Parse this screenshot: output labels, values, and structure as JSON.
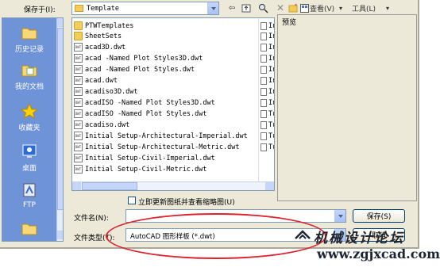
{
  "save_in": {
    "label": "保存于(I):",
    "value": "Template"
  },
  "toolbar": {
    "views_label": "查看(V)",
    "tools_label": "工具(L)"
  },
  "places": [
    {
      "label": "历史记录",
      "icon": "history-folder-icon"
    },
    {
      "label": "我的文档",
      "icon": "my-documents-icon"
    },
    {
      "label": "收藏夹",
      "icon": "favorites-star-icon"
    },
    {
      "label": "桌面",
      "icon": "desktop-icon"
    },
    {
      "label": "FTP",
      "icon": "ftp-icon"
    }
  ],
  "files": [
    {
      "name": "PTWTemplates",
      "type": "folder",
      "col2": ""
    },
    {
      "name": "SheetSets",
      "type": "folder",
      "col2": ""
    },
    {
      "name": "acad3D.dwt",
      "type": "dwt",
      "col2": "In"
    },
    {
      "name": "acad -Named Plot Styles3D.dwt",
      "type": "dwt",
      "col2": "In"
    },
    {
      "name": "acad -Named Plot Styles.dwt",
      "type": "dwt",
      "col2": "In"
    },
    {
      "name": "acad.dwt",
      "type": "dwt",
      "col2": "In"
    },
    {
      "name": "acadiso3D.dwt",
      "type": "dwt",
      "col2": "In"
    },
    {
      "name": "acadISO -Named Plot Styles3D.dwt",
      "type": "dwt",
      "col2": "In"
    },
    {
      "name": "acadISO -Named Plot Styles.dwt",
      "type": "dwt",
      "col2": "Tu"
    },
    {
      "name": "acadiso.dwt",
      "type": "dwt",
      "col2": "Tu"
    },
    {
      "name": "Initial Setup-Architectural-Imperial.dwt",
      "type": "dwt",
      "col2": "Tu"
    },
    {
      "name": "Initial Setup-Architectural-Metric.dwt",
      "type": "dwt",
      "col2": "Tu"
    },
    {
      "name": "Initial Setup-Civil-Imperial.dwt",
      "type": "dwt",
      "col2": ""
    },
    {
      "name": "Initial Setup-Civil-Metric.dwt",
      "type": "dwt",
      "col2": ""
    }
  ],
  "col2_rows": [
    {
      "text": "In"
    },
    {
      "text": "In"
    },
    {
      "text": "In"
    },
    {
      "text": "In"
    },
    {
      "text": "In"
    },
    {
      "text": "In"
    },
    {
      "text": "In"
    },
    {
      "text": "In"
    },
    {
      "text": "Tu"
    },
    {
      "text": "Tu"
    },
    {
      "text": "Tu"
    },
    {
      "text": "Tu"
    }
  ],
  "preview": {
    "label": "预览"
  },
  "options": {
    "update_thumbnail_label": "立即更新图纸并查看缩略图(U)",
    "update_thumbnail_checked": false
  },
  "filename": {
    "label": "文件名(N):",
    "value": ""
  },
  "filetype": {
    "label": "文件类型(T):",
    "value": "AutoCAD 图形样板 (*.dwt)"
  },
  "buttons": {
    "save_label": "保存(S)",
    "cancel_label": "取消"
  },
  "watermark": {
    "line1": "机械设计论坛",
    "line2": "www.zgjxcad.com"
  },
  "colors": {
    "dialog_bg": "#ece9d8",
    "places_bar": "#6f93d7",
    "highlight_ellipse": "#e0202a"
  }
}
